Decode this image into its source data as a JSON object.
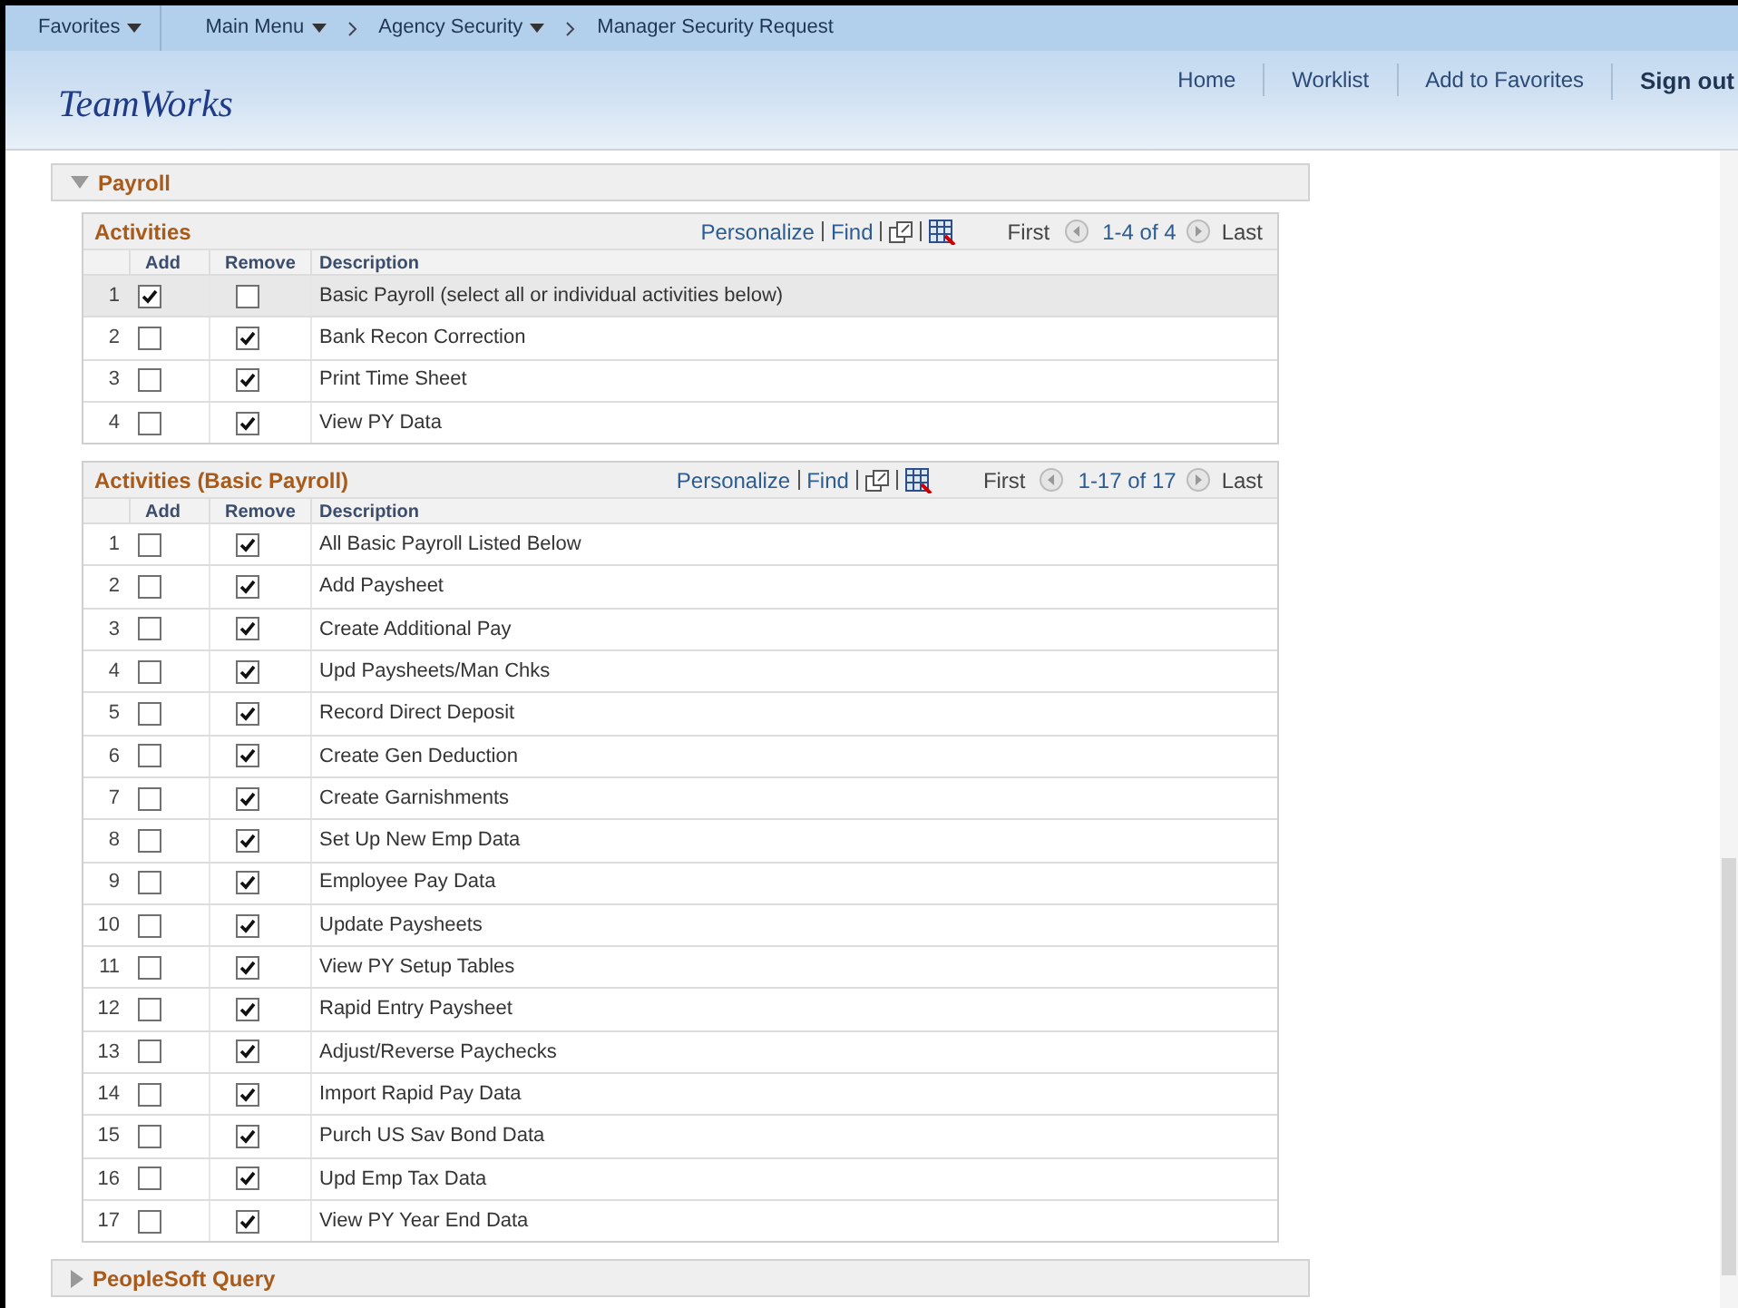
{
  "nav": {
    "items": [
      {
        "label": "Favorites",
        "dropdown": true
      },
      {
        "label": "Main Menu",
        "dropdown": true
      },
      {
        "label": "Agency Security",
        "dropdown": true
      },
      {
        "label": "Manager Security Request",
        "dropdown": false
      }
    ]
  },
  "header": {
    "logo": "TeamWorks",
    "links": [
      {
        "label": "Home",
        "bold": false
      },
      {
        "label": "Worklist",
        "bold": false
      },
      {
        "label": "Add to Favorites",
        "bold": false
      },
      {
        "label": "Sign out",
        "bold": true
      }
    ]
  },
  "sections": [
    {
      "title": "Payroll",
      "expanded": true,
      "grids": [
        {
          "title": "Activities",
          "personalize": "Personalize",
          "find": "Find",
          "first": "First",
          "range": "1-4 of 4",
          "last": "Last",
          "columns": [
            "Add",
            "Remove",
            "Description"
          ],
          "rows": [
            {
              "num": "1",
              "add": true,
              "remove": false,
              "description": "Basic Payroll (select all or individual activities below)",
              "selected": true
            },
            {
              "num": "2",
              "add": false,
              "remove": true,
              "description": "Bank Recon Correction",
              "selected": false
            },
            {
              "num": "3",
              "add": false,
              "remove": true,
              "description": "Print Time Sheet",
              "selected": false
            },
            {
              "num": "4",
              "add": false,
              "remove": true,
              "description": "View PY Data",
              "selected": false
            }
          ]
        },
        {
          "title": "Activities (Basic Payroll)",
          "personalize": "Personalize",
          "find": "Find",
          "first": "First",
          "range": "1-17 of 17",
          "last": "Last",
          "columns": [
            "Add",
            "Remove",
            "Description"
          ],
          "rows": [
            {
              "num": "1",
              "add": false,
              "remove": true,
              "description": "All Basic Payroll Listed Below",
              "selected": false
            },
            {
              "num": "2",
              "add": false,
              "remove": true,
              "description": "Add Paysheet",
              "selected": false
            },
            {
              "num": "3",
              "add": false,
              "remove": true,
              "description": "Create Additional Pay",
              "selected": false
            },
            {
              "num": "4",
              "add": false,
              "remove": true,
              "description": "Upd Paysheets/Man Chks",
              "selected": false
            },
            {
              "num": "5",
              "add": false,
              "remove": true,
              "description": "Record Direct Deposit",
              "selected": false
            },
            {
              "num": "6",
              "add": false,
              "remove": true,
              "description": "Create Gen Deduction",
              "selected": false
            },
            {
              "num": "7",
              "add": false,
              "remove": true,
              "description": "Create Garnishments",
              "selected": false
            },
            {
              "num": "8",
              "add": false,
              "remove": true,
              "description": "Set Up New Emp Data",
              "selected": false
            },
            {
              "num": "9",
              "add": false,
              "remove": true,
              "description": "Employee Pay Data",
              "selected": false
            },
            {
              "num": "10",
              "add": false,
              "remove": true,
              "description": "Update Paysheets",
              "selected": false
            },
            {
              "num": "11",
              "add": false,
              "remove": true,
              "description": "View PY Setup Tables",
              "selected": false
            },
            {
              "num": "12",
              "add": false,
              "remove": true,
              "description": "Rapid Entry Paysheet",
              "selected": false
            },
            {
              "num": "13",
              "add": false,
              "remove": true,
              "description": "Adjust/Reverse Paychecks",
              "selected": false
            },
            {
              "num": "14",
              "add": false,
              "remove": true,
              "description": "Import Rapid Pay Data",
              "selected": false
            },
            {
              "num": "15",
              "add": false,
              "remove": true,
              "description": "Purch US Sav Bond Data",
              "selected": false
            },
            {
              "num": "16",
              "add": false,
              "remove": true,
              "description": "Upd Emp Tax Data",
              "selected": false
            },
            {
              "num": "17",
              "add": false,
              "remove": true,
              "description": "View PY Year End Data",
              "selected": false
            }
          ]
        }
      ]
    },
    {
      "title": "PeopleSoft Query",
      "expanded": false
    }
  ]
}
